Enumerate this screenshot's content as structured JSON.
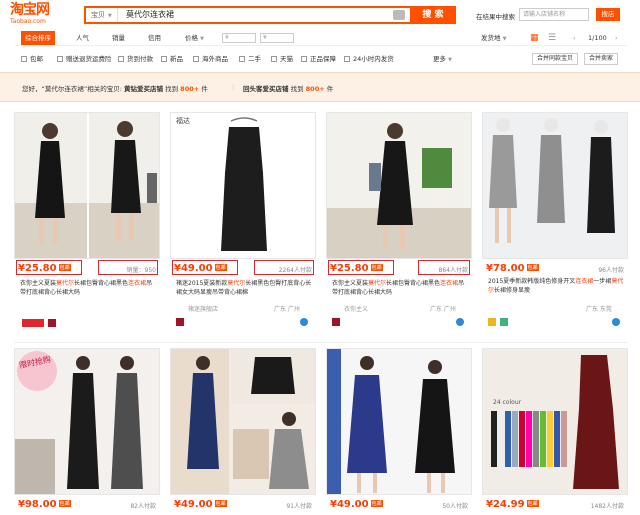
{
  "header": {
    "logo_main": "淘宝网",
    "logo_sub": "Taobao.com",
    "search_tab": "宝贝",
    "search_value": "莫代尔连衣裙",
    "search_button": "搜 索",
    "store_label": "在结果中搜索",
    "store_placeholder": "请输入店铺名称",
    "store_button": "搜店"
  },
  "sort": {
    "items": [
      "综合排序",
      "人气",
      "销量",
      "信用",
      "价格"
    ],
    "price_from": "¥",
    "price_to": "¥",
    "ship_from": "发货地",
    "page": "1/100"
  },
  "filters": {
    "items": [
      "包邮",
      "赠送退货运费险",
      "货到付款",
      "新品",
      "海外商品",
      "二手",
      "天猫",
      "正品保障",
      "24小时内发货"
    ],
    "more": "更多",
    "btn1": "合并同款宝贝",
    "btn2": "合并卖家"
  },
  "related": {
    "t1_pre": "您好，“莫代尔连衣裙”相关的宝贝:",
    "t1_mid": "黄钻爱买店铺",
    "t1_post": "找到",
    "t1_count": "800+",
    "t1_unit": "件",
    "t2_pre": "回头客爱买店铺",
    "t2_post": "找到",
    "t2_count": "800+",
    "t2_unit": "件"
  },
  "products": [
    {
      "price": "¥25.80",
      "paid": "销量：950",
      "title": "衣你主义夏装莫代尔长裙包臀背心裙黑色连衣裙吊带打底裙背心长裙大码",
      "shop": "",
      "loc": ""
    },
    {
      "price": "¥49.00",
      "paid": "2264人付款",
      "title": "褚迷2015夏装新款莫代尔长裙黑色包臀打底背心长裙女大码显瘦吊带背心裙棉",
      "shop": "褚迷旗舰店",
      "loc": "广东 广州"
    },
    {
      "price": "¥25.80",
      "paid": "864人付款",
      "title": "衣你主义夏装莫代尔长裙包臀背心裙黑色连衣裙吊带打底裙背心长裙大码",
      "shop": "衣你主义",
      "loc": "广东 广州"
    },
    {
      "price": "¥78.00",
      "paid": "96人付款",
      "title": "2015夏季新款韩版纯色修身开叉连衣裙一步裙莫代尔长裙修身显瘦",
      "shop": "",
      "loc": "广东 东莞"
    },
    {
      "price": "¥98.00",
      "paid": "82人付款"
    },
    {
      "price": "¥49.00",
      "paid": "91人付款"
    },
    {
      "price": "¥49.00",
      "paid": "50人付款"
    },
    {
      "price": "¥24.99",
      "paid": "1482人付款"
    }
  ],
  "highlights": {
    "keyword": "莫代尔",
    "keyword2": "连衣裙"
  },
  "img_text": {
    "card2": "福达",
    "card5": "限时抢购",
    "card8": "24 colour"
  },
  "colors": {
    "accent": "#ff5000",
    "price": "#ff3b00",
    "redbox": "#e0262a"
  }
}
